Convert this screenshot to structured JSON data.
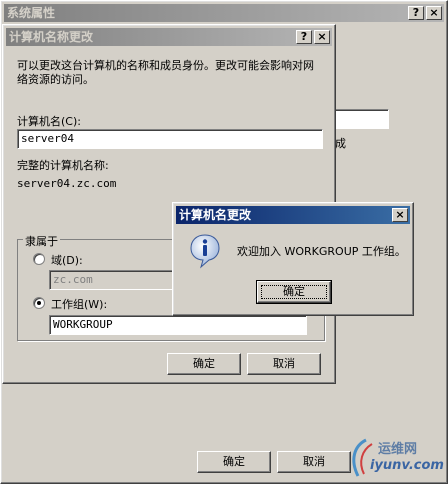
{
  "outer_window": {
    "title": "系统属性",
    "help_btn": "?",
    "close_btn": "×",
    "bg_text_cheng": "成",
    "ok_label": "确定",
    "cancel_label": "取消"
  },
  "name_dialog": {
    "title": "计算机名称更改",
    "help_btn": "?",
    "close_btn": "×",
    "description": "可以更改这台计算机的名称和成员身份。更改可能会影响对网络资源的访问。",
    "computer_name_label": "计算机名(C):",
    "computer_name_value": "server04",
    "full_name_label": "完整的计算机名称:",
    "full_name_value": "server04.zc.com",
    "member_of_label": "隶属于",
    "domain_label": "域(D):",
    "domain_value": "zc.com",
    "workgroup_label": "工作组(W):",
    "workgroup_value": "WORKGROUP",
    "ok_label": "确定",
    "cancel_label": "取消"
  },
  "message_box": {
    "title": "计算机名更改",
    "close_btn": "×",
    "message": "欢迎加入 WORKGROUP 工作组。",
    "ok_label": "确定"
  },
  "watermark": {
    "site_cn": "运维网",
    "site_url": "iyunv.com"
  }
}
